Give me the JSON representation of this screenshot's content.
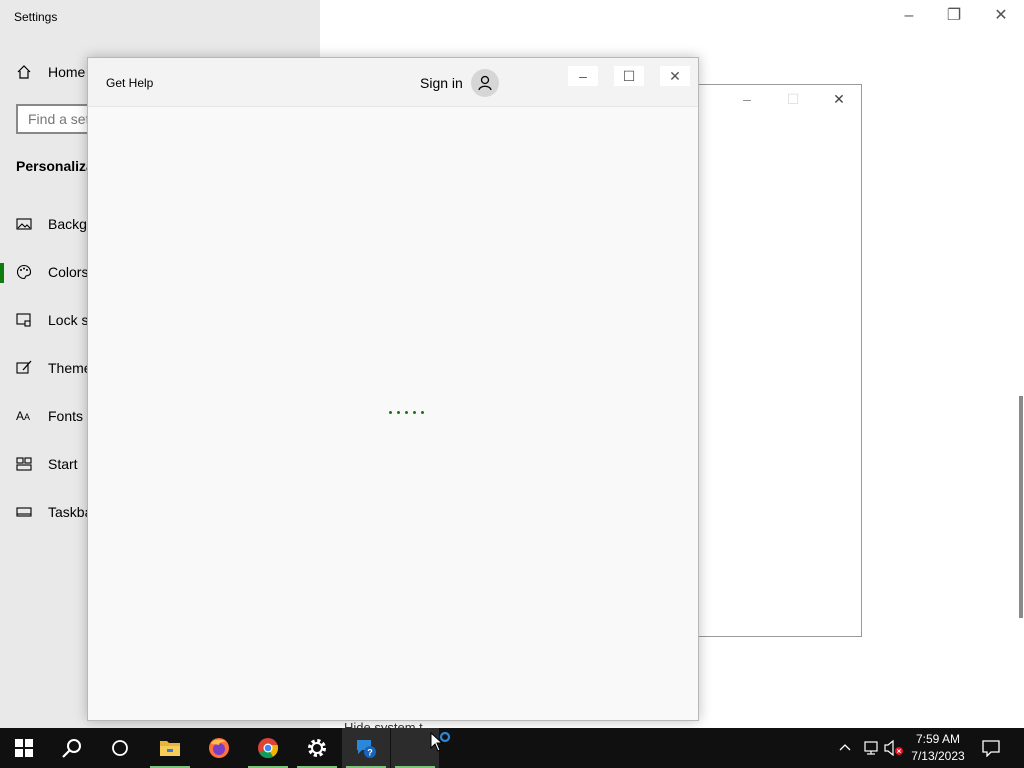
{
  "settings": {
    "title": "Settings",
    "home": "Home",
    "search_placeholder": "Find a set",
    "section": "Personaliza",
    "nav": [
      "Backgr",
      "Colors",
      "Lock sc",
      "Theme",
      "Fonts",
      "Start",
      "Taskba"
    ],
    "hidden_text": "Hide system t..."
  },
  "get_help": {
    "title": "Get Help",
    "sign_in": "Sign in"
  },
  "taskbar": {
    "apps": [
      "start-icon",
      "search-icon",
      "task-view-icon",
      "file-explorer-icon",
      "firefox-icon",
      "chrome-icon",
      "settings-icon",
      "get-help-icon",
      "blank-app-icon"
    ],
    "time": "7:59 AM",
    "date": "7/13/2023"
  },
  "colors": {
    "accent": "#107c10",
    "taskbar": "#101010"
  }
}
